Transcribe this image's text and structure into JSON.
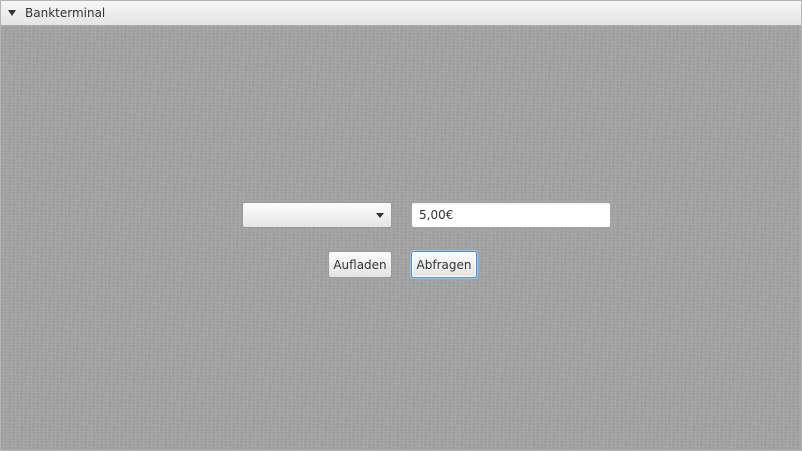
{
  "window": {
    "title": "Bankterminal"
  },
  "form": {
    "combo_value": "",
    "amount_value": "5,00€",
    "recharge_label": "Aufladen",
    "query_label": "Abfragen"
  }
}
